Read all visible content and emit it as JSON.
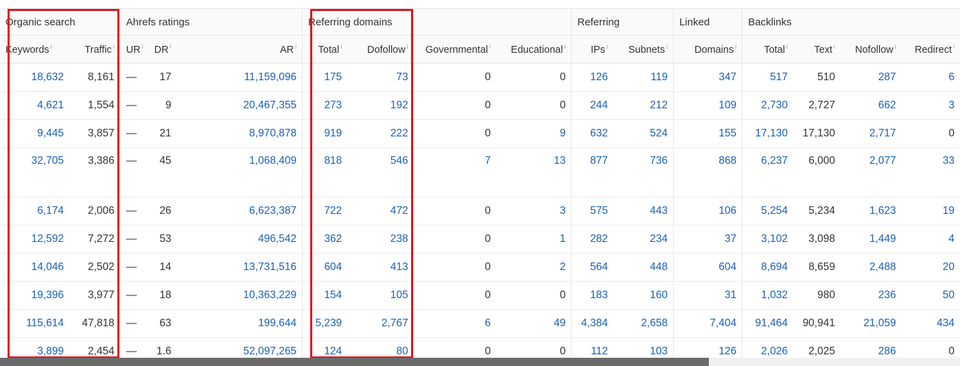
{
  "groups": {
    "organic": "Organic search",
    "ahrefs": "Ahrefs ratings",
    "refdomains": "Referring domains",
    "referring": "Referring",
    "linked": "Linked",
    "backlinks": "Backlinks"
  },
  "columns": {
    "keywords": "Keywords",
    "traffic": "Traffic",
    "ur": "UR",
    "dr": "DR",
    "ar": "AR",
    "total": "Total",
    "dofollow": "Dofollow",
    "governmental": "Governmental",
    "educational": "Educational",
    "ips": "IPs",
    "subnets": "Subnets",
    "domains": "Domains",
    "bl_total": "Total",
    "text": "Text",
    "nofollow": "Nofollow",
    "redirect": "Redirect"
  },
  "info_glyph": "i",
  "rows": [
    {
      "keywords": "18,632",
      "traffic": "8,161",
      "ur": "—",
      "dr": "17",
      "ar": "11,159,096",
      "total": "175",
      "dofollow": "73",
      "governmental": "0",
      "educational": "0",
      "ips": "126",
      "subnets": "119",
      "domains": "347",
      "bl_total": "517",
      "text": "510",
      "nofollow": "287",
      "redirect": "6"
    },
    {
      "keywords": "4,621",
      "traffic": "1,554",
      "ur": "—",
      "dr": "9",
      "ar": "20,467,355",
      "total": "273",
      "dofollow": "192",
      "governmental": "0",
      "educational": "0",
      "ips": "244",
      "subnets": "212",
      "domains": "109",
      "bl_total": "2,730",
      "text": "2,727",
      "nofollow": "662",
      "redirect": "3"
    },
    {
      "keywords": "9,445",
      "traffic": "3,857",
      "ur": "—",
      "dr": "21",
      "ar": "8,970,878",
      "total": "919",
      "dofollow": "222",
      "governmental": "0",
      "educational": "9",
      "ips": "632",
      "subnets": "524",
      "domains": "155",
      "bl_total": "17,130",
      "text": "17,130",
      "nofollow": "2,717",
      "redirect": "0"
    },
    {
      "keywords": "32,705",
      "traffic": "3,386",
      "ur": "—",
      "dr": "45",
      "ar": "1,068,409",
      "total": "818",
      "dofollow": "546",
      "governmental": "7",
      "educational": "13",
      "ips": "877",
      "subnets": "736",
      "domains": "868",
      "bl_total": "6,237",
      "text": "6,000",
      "nofollow": "2,077",
      "redirect": "33"
    },
    {
      "keywords": "6,174",
      "traffic": "2,006",
      "ur": "—",
      "dr": "26",
      "ar": "6,623,387",
      "total": "722",
      "dofollow": "472",
      "governmental": "0",
      "educational": "3",
      "ips": "575",
      "subnets": "443",
      "domains": "106",
      "bl_total": "5,254",
      "text": "5,234",
      "nofollow": "1,623",
      "redirect": "19"
    },
    {
      "keywords": "12,592",
      "traffic": "7,272",
      "ur": "—",
      "dr": "53",
      "ar": "496,542",
      "total": "362",
      "dofollow": "238",
      "governmental": "0",
      "educational": "1",
      "ips": "282",
      "subnets": "234",
      "domains": "37",
      "bl_total": "3,102",
      "text": "3,098",
      "nofollow": "1,449",
      "redirect": "4"
    },
    {
      "keywords": "14,046",
      "traffic": "2,502",
      "ur": "—",
      "dr": "14",
      "ar": "13,731,516",
      "total": "604",
      "dofollow": "413",
      "governmental": "0",
      "educational": "2",
      "ips": "564",
      "subnets": "448",
      "domains": "604",
      "bl_total": "8,694",
      "text": "8,659",
      "nofollow": "2,488",
      "redirect": "20"
    },
    {
      "keywords": "19,396",
      "traffic": "3,977",
      "ur": "—",
      "dr": "18",
      "ar": "10,363,229",
      "total": "154",
      "dofollow": "105",
      "governmental": "0",
      "educational": "0",
      "ips": "183",
      "subnets": "160",
      "domains": "31",
      "bl_total": "1,032",
      "text": "980",
      "nofollow": "236",
      "redirect": "50"
    },
    {
      "keywords": "115,614",
      "traffic": "47,818",
      "ur": "—",
      "dr": "63",
      "ar": "199,644",
      "total": "5,239",
      "dofollow": "2,767",
      "governmental": "6",
      "educational": "49",
      "ips": "4,384",
      "subnets": "2,658",
      "domains": "7,404",
      "bl_total": "91,464",
      "text": "90,941",
      "nofollow": "21,059",
      "redirect": "434"
    },
    {
      "keywords": "3,899",
      "traffic": "2,454",
      "ur": "—",
      "dr": "1.6",
      "ar": "52,097,265",
      "total": "124",
      "dofollow": "80",
      "governmental": "0",
      "educational": "0",
      "ips": "112",
      "subnets": "103",
      "domains": "126",
      "bl_total": "2,026",
      "text": "2,025",
      "nofollow": "286",
      "redirect": "0"
    }
  ],
  "colors": {
    "link": "#1a5fb4",
    "highlight": "#e3141b",
    "header_bg": "#fafafa"
  }
}
